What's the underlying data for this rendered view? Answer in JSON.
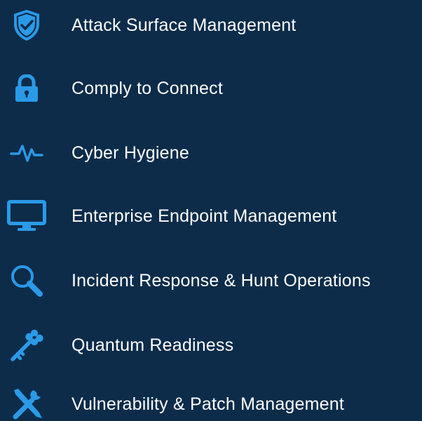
{
  "menu": {
    "items": [
      {
        "label": "Attack Surface Management",
        "icon": "shield-check-icon"
      },
      {
        "label": "Comply to Connect",
        "icon": "padlock-icon"
      },
      {
        "label": "Cyber Hygiene",
        "icon": "pulse-heartbeat-icon"
      },
      {
        "label": "Enterprise Endpoint Management",
        "icon": "desktop-monitor-icon"
      },
      {
        "label": "Incident Response & Hunt Operations",
        "icon": "magnifying-glass-icon"
      },
      {
        "label": "Quantum Readiness",
        "icon": "key-icon"
      },
      {
        "label": "Vulnerability & Patch Management",
        "icon": "wrench-screwdriver-icon"
      }
    ]
  },
  "colors": {
    "background": "#0c2c4a",
    "accent": "#2a9ae8",
    "text": "#ffffff"
  }
}
